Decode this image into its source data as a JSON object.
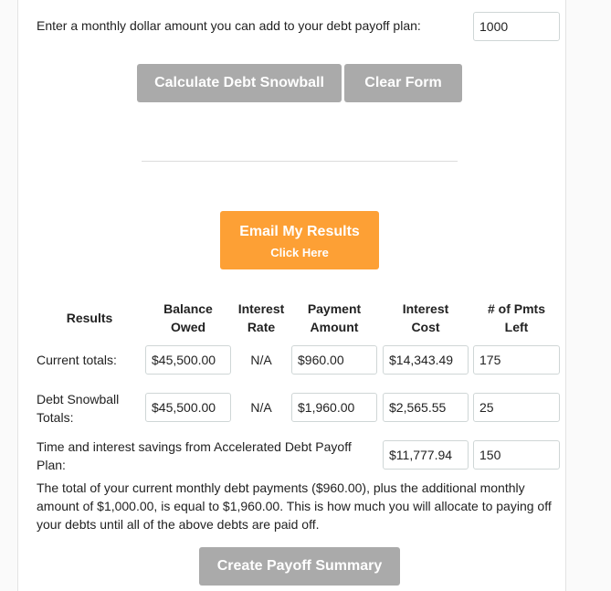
{
  "extra_payment": {
    "label": "Enter a monthly dollar amount you can add to your debt payoff plan:",
    "value": "1000"
  },
  "buttons": {
    "calculate": "Calculate Debt Snowball",
    "clear": "Clear Form",
    "email_line1": "Email My Results",
    "email_line2": "Click Here",
    "create_summary": "Create Payoff Summary"
  },
  "results": {
    "headers": {
      "results": "Results",
      "balance_l1": "Balance",
      "balance_l2": "Owed",
      "rate_l1": "Interest",
      "rate_l2": "Rate",
      "payment_l1": "Payment",
      "payment_l2": "Amount",
      "cost_l1": "Interest",
      "cost_l2": "Cost",
      "pmts_l1": "# of Pmts",
      "pmts_l2": "Left"
    },
    "current": {
      "label": "Current totals:",
      "balance": "$45,500.00",
      "rate": "N/A",
      "payment": "$960.00",
      "interest_cost": "$14,343.49",
      "pmts_left": "175"
    },
    "snowball": {
      "label_l1": "Debt Snowball",
      "label_l2": "Totals:",
      "balance": "$45,500.00",
      "rate": "N/A",
      "payment": "$1,960.00",
      "interest_cost": "$2,565.55",
      "pmts_left": "25"
    },
    "savings": {
      "label_l1": "Time and interest savings from Accelerated Debt Payoff",
      "label_l2": "Plan:",
      "interest_cost": "$11,777.94",
      "pmts_left": "150"
    }
  },
  "summary_text": "The total of your current monthly debt payments ($960.00), plus the additional monthly amount of $1,000.00, is equal to $1,960.00. This is how much you will allocate to paying off your debts until all of the above debts are paid off.",
  "colors": {
    "gray_button": "#aaaaaa",
    "orange_button": "#fda035"
  }
}
